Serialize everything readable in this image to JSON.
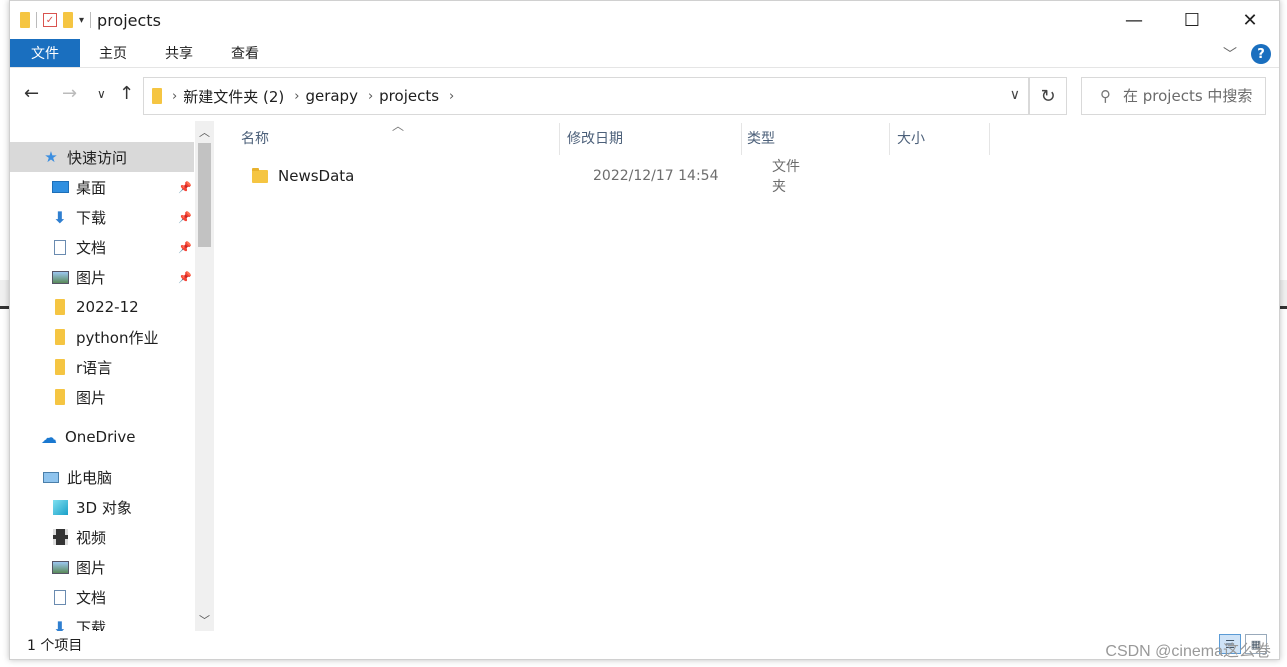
{
  "window": {
    "title": "projects",
    "controls": {
      "minimize": "—",
      "maximize": "☐",
      "close": "✕"
    }
  },
  "ribbon": {
    "tabs": [
      "文件",
      "主页",
      "共享",
      "查看"
    ],
    "help_label": "?"
  },
  "address": {
    "crumbs": [
      "新建文件夹 (2)",
      "gerapy",
      "projects"
    ],
    "search_placeholder": "在 projects 中搜索"
  },
  "nav": {
    "quick_access": "快速访问",
    "items": [
      "桌面",
      "下载",
      "文档",
      "图片",
      "2022-12",
      "python作业",
      "r语言",
      "图片"
    ],
    "onedrive": "OneDrive",
    "this_pc": "此电脑",
    "pc_items": [
      "3D 对象",
      "视频",
      "图片",
      "文档",
      "下载"
    ]
  },
  "columns": {
    "name": "名称",
    "modified": "修改日期",
    "type": "类型",
    "size": "大小"
  },
  "files": [
    {
      "name": "NewsData",
      "modified": "2022/12/17 14:54",
      "type": "文件夹"
    }
  ],
  "status": {
    "count": "1 个项目"
  },
  "watermark": "CSDN @cinema这么卷",
  "colors": {
    "accent": "#1a6fbf",
    "folder": "#f5c542",
    "selected_nav": "#d9d9d9"
  }
}
